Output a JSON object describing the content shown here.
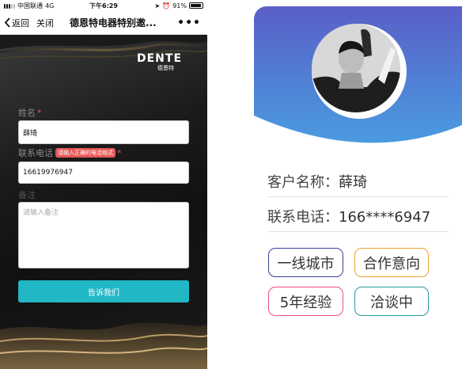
{
  "status_bar": {
    "carrier": "中国联通",
    "network": "4G",
    "time": "下午6:29",
    "battery": "91%"
  },
  "nav": {
    "back_label": "返回",
    "close_label": "关闭",
    "title": "德恩特电器特别邀...",
    "more_label": "•••"
  },
  "logo": {
    "brand": "DENTE",
    "brand_cn": "德恩特"
  },
  "form": {
    "name_label": "姓名",
    "name_required": "*",
    "name_value": "薛琦",
    "phone_label": "联系电话",
    "phone_error": "请输入正确的电话格式",
    "phone_required": "*",
    "phone_value": "16619976947",
    "remark_label": "备注",
    "remark_placeholder": "请输入备注",
    "submit_label": "告诉我们"
  },
  "card": {
    "customer_label": "客户名称：",
    "customer_value": "薛琦",
    "phone_label": "联系电话：",
    "phone_value": "166****6947",
    "tags": [
      {
        "label": "一线城市",
        "color": "#3a3f9c"
      },
      {
        "label": "合作意向",
        "color": "#f0a030"
      },
      {
        "label": "5年经验",
        "color": "#e8507a"
      },
      {
        "label": "洽谈中",
        "color": "#2a9d9a"
      }
    ],
    "gradient_top": "#5a5fc8",
    "gradient_bottom": "#4a9be0"
  },
  "colors": {
    "submit_button": "#21b7c5",
    "error_badge": "#e85858"
  }
}
